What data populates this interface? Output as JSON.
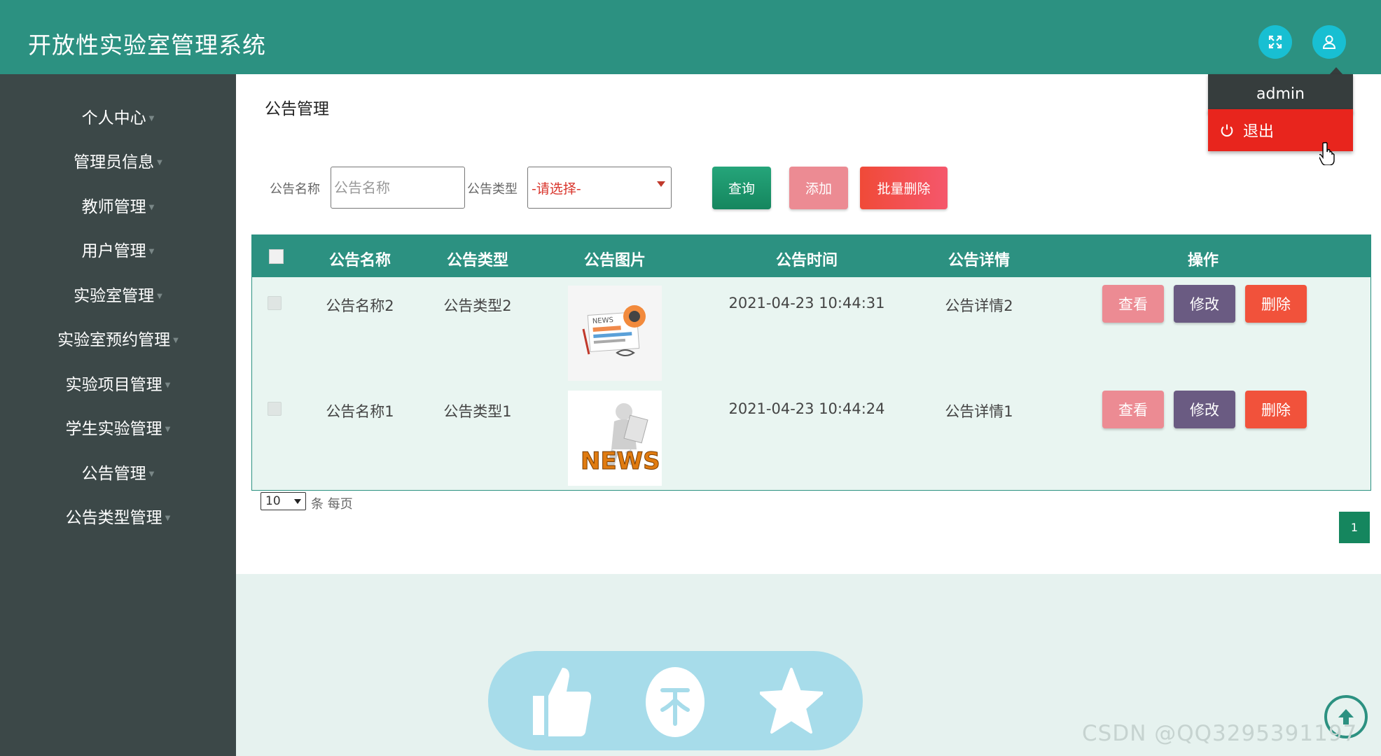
{
  "header": {
    "title": "开放性实验室管理系统",
    "icons": {
      "fullscreen": "fullscreen-icon",
      "user": "user-icon"
    }
  },
  "sidebar": {
    "items": [
      {
        "label": "个人中心"
      },
      {
        "label": "管理员信息"
      },
      {
        "label": "教师管理"
      },
      {
        "label": "用户管理"
      },
      {
        "label": "实验室管理"
      },
      {
        "label": "实验室预约管理"
      },
      {
        "label": "实验项目管理"
      },
      {
        "label": "学生实验管理"
      },
      {
        "label": "公告管理"
      },
      {
        "label": "公告类型管理"
      }
    ]
  },
  "main": {
    "page_title": "公告管理",
    "search": {
      "name_label": "公告名称",
      "name_placeholder": "公告名称",
      "type_label": "公告类型",
      "type_selected": "-请选择-"
    },
    "buttons": {
      "query": "查询",
      "add": "添加",
      "batch_delete": "批量删除"
    },
    "table": {
      "columns": [
        "公告名称",
        "公告类型",
        "公告图片",
        "公告时间",
        "公告详情",
        "操作"
      ],
      "rows": [
        {
          "name": "公告名称2",
          "type": "公告类型2",
          "image_icon": "newspaper-icon",
          "time": "2021-04-23 10:44:31",
          "detail": "公告详情2"
        },
        {
          "name": "公告名称1",
          "type": "公告类型1",
          "image_icon": "news-figure-icon",
          "time": "2021-04-23 10:44:24",
          "detail": "公告详情1"
        }
      ],
      "actions": {
        "view": "查看",
        "edit": "修改",
        "delete": "删除"
      }
    },
    "pagination": {
      "page_size": "10",
      "per_page_text": "条 每页",
      "current_page": "1"
    }
  },
  "user_menu": {
    "username": "admin",
    "logout": "退出"
  },
  "float_bar": {
    "icons": [
      "thumbs-up-icon",
      "coin-icon",
      "star-icon"
    ]
  },
  "watermark": "CSDN @QQ3295391197",
  "colors": {
    "header": "#2c9181",
    "sidebar": "#3c4848",
    "accent_green": "#15865e",
    "danger": "#f1523b",
    "logout_red": "#e8251d"
  }
}
